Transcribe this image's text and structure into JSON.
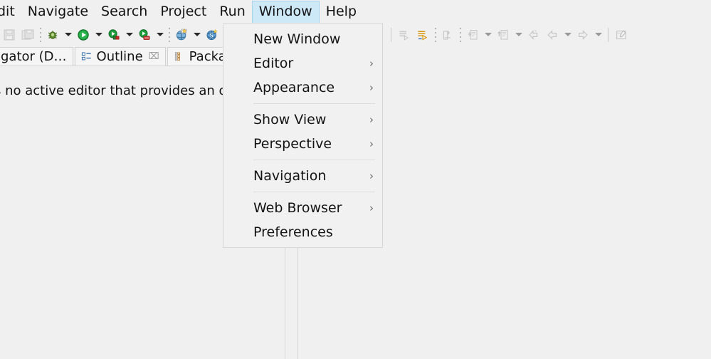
{
  "menubar": {
    "items": [
      {
        "label": "dit",
        "clipped": true,
        "active": false,
        "name": "menu-edit"
      },
      {
        "label": "Navigate",
        "clipped": false,
        "active": false,
        "name": "menu-navigate"
      },
      {
        "label": "Search",
        "clipped": false,
        "active": false,
        "name": "menu-search"
      },
      {
        "label": "Project",
        "clipped": false,
        "active": false,
        "name": "menu-project"
      },
      {
        "label": "Run",
        "clipped": false,
        "active": false,
        "name": "menu-run"
      },
      {
        "label": "Window",
        "clipped": false,
        "active": true,
        "name": "menu-window"
      },
      {
        "label": "Help",
        "clipped": false,
        "active": false,
        "name": "menu-help"
      }
    ],
    "active_highlight_color": "#cde8f7"
  },
  "dropdown": {
    "owner": "Window",
    "items": [
      {
        "label": "New Window",
        "submenu": false,
        "arrow": "",
        "name": "menu-item-new-window"
      },
      {
        "label": "Editor",
        "submenu": true,
        "arrow": "›",
        "name": "menu-item-editor"
      },
      {
        "label": "Appearance",
        "submenu": true,
        "arrow": "›",
        "name": "menu-item-appearance"
      },
      {
        "separator": true
      },
      {
        "label": "Show View",
        "submenu": true,
        "arrow": "›",
        "name": "menu-item-show-view"
      },
      {
        "label": "Perspective",
        "submenu": true,
        "arrow": "›",
        "name": "menu-item-perspective"
      },
      {
        "separator": true
      },
      {
        "label": "Navigation",
        "submenu": true,
        "arrow": "›",
        "name": "menu-item-navigation"
      },
      {
        "separator": true
      },
      {
        "label": "Web Browser",
        "submenu": true,
        "arrow": "›",
        "name": "menu-item-web-browser"
      },
      {
        "label": "Preferences",
        "submenu": false,
        "arrow": "",
        "name": "menu-item-preferences"
      }
    ]
  },
  "toolbar": {
    "groups": [
      {
        "type": "icon",
        "icon": "save-icon",
        "enabled": false
      },
      {
        "type": "icon",
        "icon": "save-all-icon",
        "enabled": false
      },
      {
        "type": "dots"
      },
      {
        "type": "icon",
        "icon": "debug-bug-icon",
        "enabled": true
      },
      {
        "type": "arrow",
        "icon": "debug-dropdown-arrow",
        "enabled": true
      },
      {
        "type": "icon",
        "icon": "run-play-icon",
        "enabled": true
      },
      {
        "type": "arrow",
        "icon": "run-dropdown-arrow",
        "enabled": true
      },
      {
        "type": "icon",
        "icon": "run-external-tools-icon",
        "enabled": true
      },
      {
        "type": "arrow",
        "icon": "external-tools-dropdown-arrow",
        "enabled": true
      },
      {
        "type": "icon",
        "icon": "run-server-icon",
        "enabled": true
      },
      {
        "type": "arrow",
        "icon": "server-dropdown-arrow",
        "enabled": true
      },
      {
        "type": "dots"
      },
      {
        "type": "icon",
        "icon": "new-wizard-icon",
        "enabled": true
      },
      {
        "type": "arrow",
        "icon": "new-wizard-dropdown-arrow",
        "enabled": true
      },
      {
        "type": "icon",
        "icon": "search-globe-icon",
        "enabled": true
      },
      {
        "type": "arrow",
        "icon": "search-dropdown-arrow",
        "enabled": true
      },
      {
        "type": "gap"
      },
      {
        "type": "icon",
        "icon": "resume-icon",
        "enabled": false
      },
      {
        "type": "icon",
        "icon": "suspend-icon",
        "enabled": false
      },
      {
        "type": "icon",
        "icon": "terminate-icon",
        "enabled": false
      },
      {
        "type": "icon",
        "icon": "disconnect-icon",
        "enabled": false
      },
      {
        "type": "icon",
        "icon": "step-into-icon",
        "enabled": false
      },
      {
        "type": "icon",
        "icon": "step-over-icon",
        "enabled": false
      },
      {
        "type": "icon",
        "icon": "step-return-icon",
        "enabled": false
      },
      {
        "type": "line"
      },
      {
        "type": "icon",
        "icon": "next-annotation-icon",
        "enabled": false
      },
      {
        "type": "icon",
        "icon": "previous-annotation-icon",
        "enabled": true
      },
      {
        "type": "dots"
      },
      {
        "type": "icon",
        "icon": "open-type-icon",
        "enabled": false
      },
      {
        "type": "dots"
      },
      {
        "type": "icon",
        "icon": "open-task-icon",
        "enabled": false
      },
      {
        "type": "arrow",
        "icon": "open-task-dropdown-arrow",
        "enabled": false
      },
      {
        "type": "icon",
        "icon": "last-edit-location-icon",
        "enabled": false
      },
      {
        "type": "arrow",
        "icon": "last-edit-dropdown-arrow",
        "enabled": false
      },
      {
        "type": "icon",
        "icon": "back-arrow-icon",
        "enabled": false
      },
      {
        "type": "icon",
        "icon": "back-history-icon",
        "enabled": false
      },
      {
        "type": "arrow",
        "icon": "back-dropdown-arrow",
        "enabled": false
      },
      {
        "type": "icon",
        "icon": "forward-arrow-icon",
        "enabled": false
      },
      {
        "type": "arrow",
        "icon": "forward-dropdown-arrow",
        "enabled": false
      },
      {
        "type": "line"
      },
      {
        "type": "icon",
        "icon": "pin-editor-icon",
        "enabled": false
      }
    ]
  },
  "view_tabs": {
    "tabs": [
      {
        "label": "gator (D…",
        "icon": "navigator-icon",
        "closable": false,
        "active": false,
        "name": "tab-navigator"
      },
      {
        "label": "Outline",
        "icon": "outline-icon",
        "closable": true,
        "close_glyph": "⌧",
        "active": true,
        "name": "tab-outline"
      },
      {
        "label": "Package E",
        "icon": "package-explorer-icon",
        "closable": false,
        "active": false,
        "name": "tab-package-explorer"
      }
    ]
  },
  "outline_view": {
    "message": "s no active editor that provides an ou"
  },
  "colors": {
    "window_background": "#f0f0f0",
    "menu_background": "#f1f1f1",
    "menu_border": "#d6d6d6",
    "highlight": "#cde8f7",
    "text": "#141414",
    "divider": "#d8d8d8"
  }
}
